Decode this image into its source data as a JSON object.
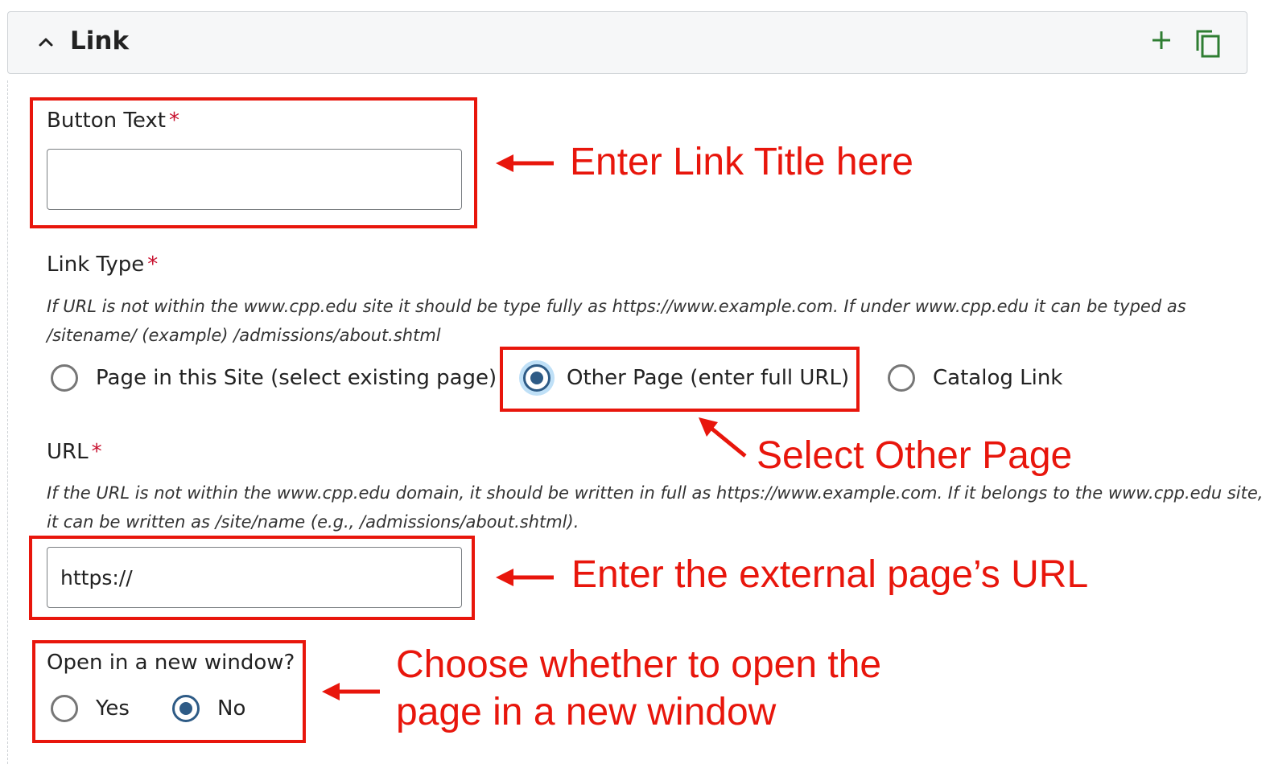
{
  "section": {
    "title": "Link",
    "collapse_icon": "chevron-up-icon",
    "add_icon": "plus-icon",
    "duplicate_icon": "copy-icon",
    "accent_color": "#2e7d32"
  },
  "fields": {
    "button_text": {
      "label": "Button Text",
      "required_mark": "*",
      "value": ""
    },
    "link_type": {
      "label": "Link Type",
      "required_mark": "*",
      "help_line1": "If URL is not within the www.cpp.edu site it should be type fully as https://www.example.com. If under www.cpp.edu it can be typed as",
      "help_line2": "/sitename/ (example) /admissions/about.shtml",
      "options": [
        {
          "label": "Page in this Site (select existing page)",
          "selected": false
        },
        {
          "label": "Other Page (enter full URL)",
          "selected": true
        },
        {
          "label": "Catalog Link",
          "selected": false
        }
      ]
    },
    "url": {
      "label": "URL",
      "required_mark": "*",
      "help_line1": "If the URL is not within the www.cpp.edu domain, it should be written in full as https://www.example.com. If it belongs to the www.cpp.edu site,",
      "help_line2": "it can be written as /site/name (e.g., /admissions/about.shtml).",
      "value": "https://"
    },
    "new_window": {
      "label": "Open in a new window?",
      "options": [
        {
          "label": "Yes",
          "selected": false
        },
        {
          "label": "No",
          "selected": true
        }
      ]
    }
  },
  "annotations": {
    "color": "#e8160c",
    "title_note": "Enter Link Title here",
    "type_note": "Select Other Page",
    "url_note": "Enter the external page’s URL",
    "window_note_line1": "Choose whether to open the",
    "window_note_line2": "page in a new window"
  }
}
